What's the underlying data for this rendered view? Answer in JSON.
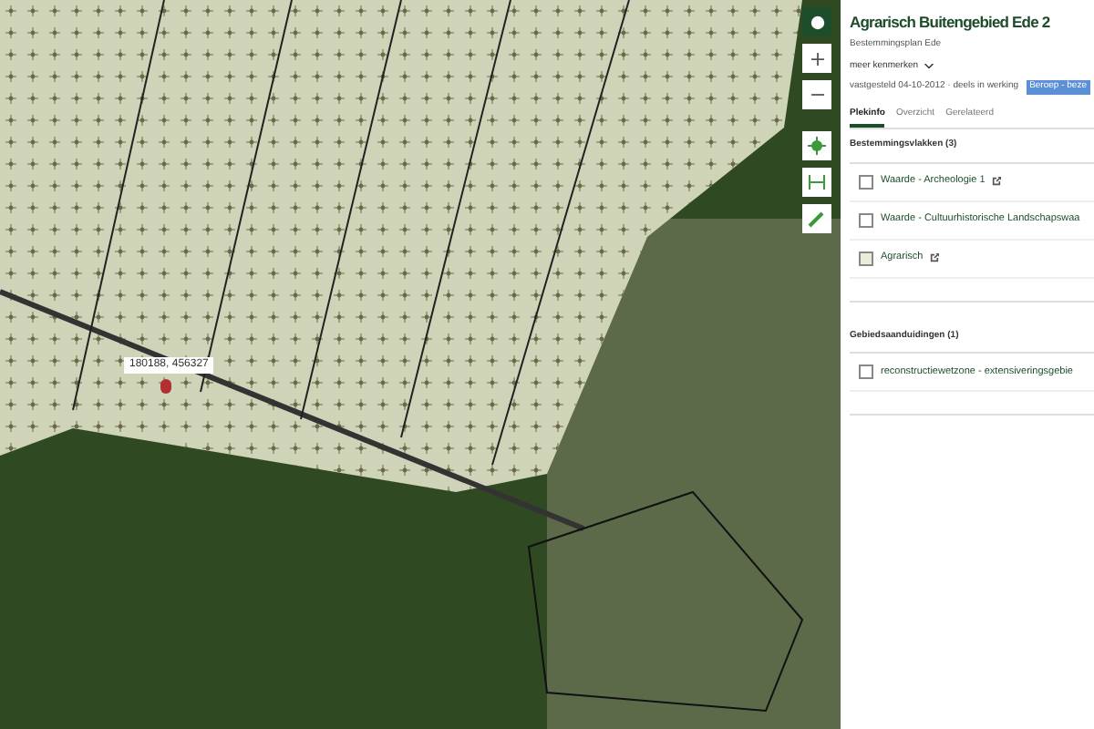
{
  "map": {
    "coordinate_label": "180188, 456327"
  },
  "panel": {
    "title": "Agrarisch Buitengebied Ede 2",
    "subtitle": "Bestemmingsplan Ede",
    "more_link": "meer kenmerken",
    "status": "vastgesteld 04-10-2012 · deels in werking",
    "badge": "Beroep - beze",
    "tabs": [
      {
        "label": "Plekinfo",
        "selected": true
      },
      {
        "label": "Overzicht",
        "selected": false
      },
      {
        "label": "Gerelateerd",
        "selected": false
      }
    ],
    "sections": [
      {
        "heading": "Bestemmingsvlakken (3)",
        "items": [
          {
            "label": "Waarde - Archeologie 1",
            "external_link": true,
            "color": "#ffffff"
          },
          {
            "label": "Waarde - Cultuurhistorische Landschapswaa",
            "external_link": false,
            "color": "#ffffff"
          },
          {
            "label": "Agrarisch",
            "external_link": true,
            "color": "#e8eed8"
          }
        ]
      },
      {
        "heading": "Gebiedsaanduidingen (1)",
        "items": [
          {
            "label": "reconstructiewetzone - extensiveringsgebie",
            "external_link": false,
            "color": "#ffffff"
          }
        ]
      }
    ]
  }
}
